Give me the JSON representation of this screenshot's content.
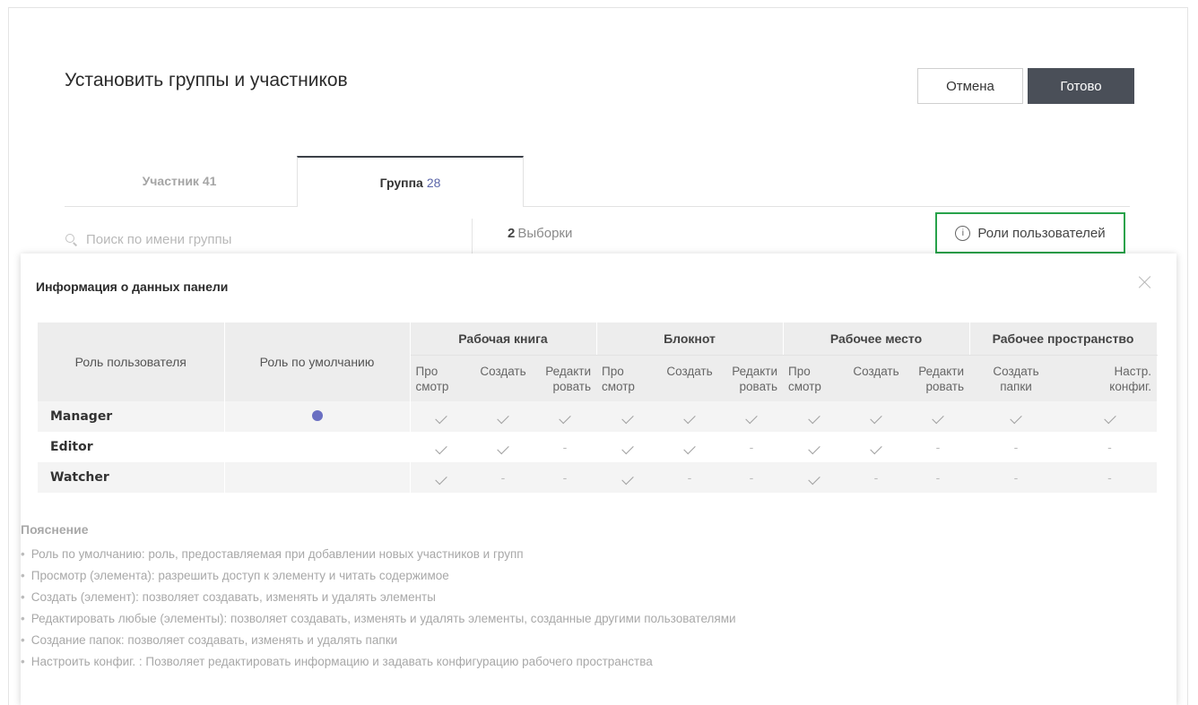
{
  "dialog": {
    "title": "Установить группы и участников",
    "cancel_label": "Отмена",
    "done_label": "Готово"
  },
  "tabs": {
    "member_label": "Участник 41",
    "group_label": "Группа",
    "group_count": "28"
  },
  "toolbar": {
    "search_placeholder": "Поиск по имени группы",
    "selection_count": "2",
    "selection_label": "Выборки",
    "roles_link_label": "Роли пользователей"
  },
  "panel": {
    "title": "Информация о данных панели",
    "table": {
      "col_role": "Роль пользователя",
      "col_default": "Роль по умолчанию",
      "groups": [
        "Рабочая книга",
        "Блокнот",
        "Рабочее место",
        "Рабочее пространство"
      ],
      "sub": {
        "view": [
          "Про",
          "смотр"
        ],
        "create": "Создать",
        "edit": [
          "Редакти",
          "ровать"
        ],
        "folders": [
          "Создать",
          "папки"
        ],
        "config": [
          "Настр.",
          "конфиг."
        ]
      },
      "rows": [
        {
          "name": "Manager",
          "default": true,
          "perms": [
            "v",
            "v",
            "v",
            "v",
            "v",
            "v",
            "v",
            "v",
            "v",
            "v",
            "v"
          ]
        },
        {
          "name": "Editor",
          "default": false,
          "perms": [
            "v",
            "v",
            "-",
            "v",
            "v",
            "-",
            "v",
            "v",
            "-",
            "-",
            "-"
          ]
        },
        {
          "name": "Watcher",
          "default": false,
          "perms": [
            "v",
            "-",
            "-",
            "v",
            "-",
            "-",
            "v",
            "-",
            "-",
            "-",
            "-"
          ]
        }
      ],
      "dash": "-"
    },
    "legend": {
      "title": "Пояснение",
      "items": [
        "Роль по умолчанию: роль, предоставляемая при добавлении новых участников и групп",
        "Просмотр (элемента): разрешить доступ к элементу и читать содержимое",
        "Создать (элемент): позволяет создавать, изменять и удалять элементы",
        "Редактировать любые (элементы): позволяет создавать, изменять и удалять элементы, созданные другими пользователями",
        "Создание папок: позволяет создавать, изменять и удалять папки",
        "Настроить конфиг. : Позволяет редактировать информацию и задавать конфигурацию рабочего пространства"
      ]
    }
  },
  "colors": {
    "highlight_border": "#27a24a",
    "primary_button": "#4a4f58",
    "default_dot": "#6a6fc2",
    "count_accent": "#5a64a8"
  },
  "icons": [
    "search-icon",
    "info-icon",
    "close-icon",
    "check-icon",
    "default-role-dot"
  ]
}
